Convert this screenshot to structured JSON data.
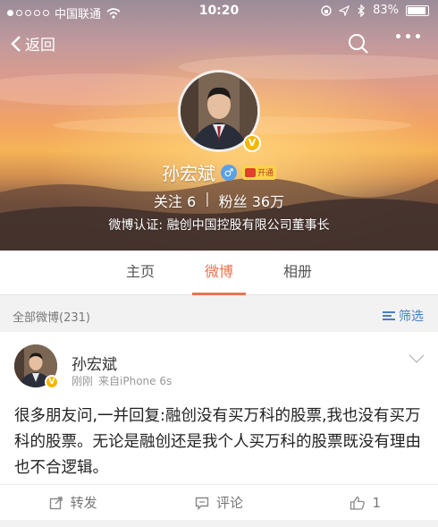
{
  "status_bar": {
    "carrier": "中国联通",
    "time": "10:20",
    "battery": "83%",
    "battery_level": 0.83
  },
  "navbar": {
    "back_label": "返回"
  },
  "profile": {
    "name": "孙宏斌",
    "vip_label": "开通",
    "following_label": "关注",
    "following_count": "6",
    "followers_label": "粉丝",
    "followers_count": "36万",
    "verification": "微博认证: 融创中国控股有限公司董事长"
  },
  "tabs": [
    {
      "label": "主页",
      "active": false
    },
    {
      "label": "微博",
      "active": true
    },
    {
      "label": "相册",
      "active": false
    }
  ],
  "feed": {
    "all_count": "全部微博(231)",
    "filter_label": "筛选"
  },
  "post": {
    "author": "孙宏斌",
    "time": "刚刚",
    "source": "来自iPhone 6s",
    "text": "很多朋友问,一并回复:融创没有买万科的股票,我也没有买万科的股票。无论是融创还是我个人买万科的股票既没有理由也不合逻辑。",
    "repost_label": "转发",
    "comment_label": "评论",
    "like_count": "1"
  },
  "colors": {
    "accent": "#eb7350",
    "link": "#4a7fc1",
    "verified_badge": "#f5b800"
  }
}
